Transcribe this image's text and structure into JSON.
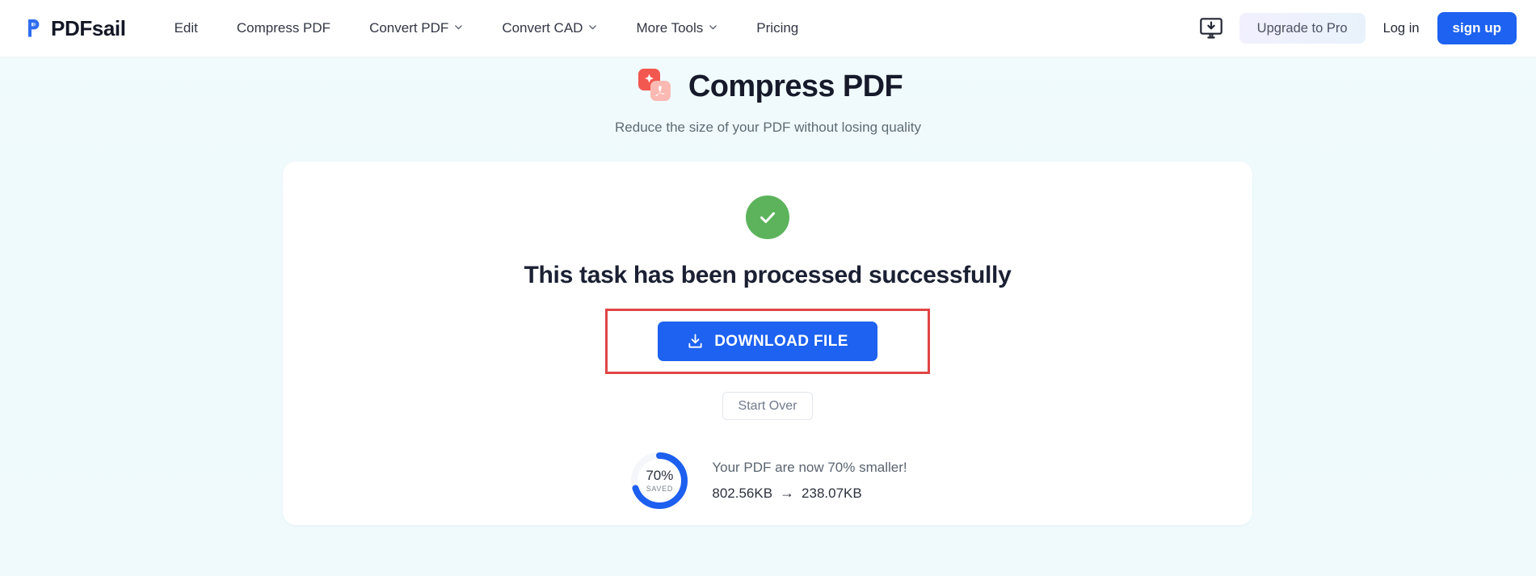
{
  "brand": {
    "name": "PDFsail",
    "logo_icon": "pdfsail-logo-icon",
    "accent": "#1d62f0"
  },
  "nav": {
    "items": [
      {
        "label": "Edit",
        "has_chevron": false
      },
      {
        "label": "Compress PDF",
        "has_chevron": false
      },
      {
        "label": "Convert PDF",
        "has_chevron": true
      },
      {
        "label": "Convert CAD",
        "has_chevron": true
      },
      {
        "label": "More Tools",
        "has_chevron": true
      },
      {
        "label": "Pricing",
        "has_chevron": false
      }
    ]
  },
  "header_right": {
    "desktop_icon": "desktop-download-icon",
    "upgrade_label": "Upgrade to Pro",
    "login_label": "Log in",
    "signup_label": "sign up"
  },
  "hero": {
    "icon": "compress-pdf-icon",
    "title": "Compress PDF",
    "subtitle": "Reduce the size of your PDF without losing quality"
  },
  "result": {
    "status_icon": "success-check-icon",
    "status_color": "#5cb35b",
    "title": "This task has been processed successfully",
    "download_label": "DOWNLOAD FILE",
    "download_icon": "download-icon",
    "highlight_color": "#e04646",
    "start_over_label": "Start Over"
  },
  "stats": {
    "percent_label": "70%",
    "saved_label": "SAVED",
    "percent_value": 70,
    "donut_color": "#1d5fef",
    "donut_track_color": "#f3f5f9",
    "message": "Your PDF are now 70% smaller!",
    "original_size": "802.56KB",
    "arrow": "→",
    "compressed_size": "238.07KB"
  }
}
